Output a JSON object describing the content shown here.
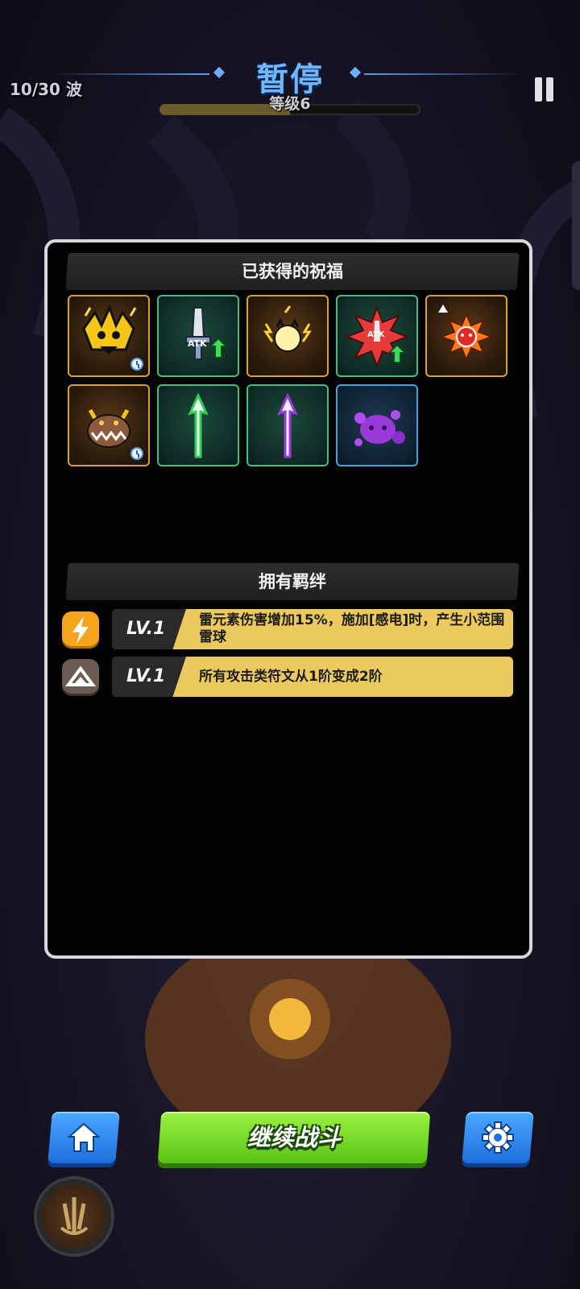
{
  "hud": {
    "wave": "10/30 波",
    "title": "暂停",
    "level": "等级6",
    "level_progress": 0.5
  },
  "panel": {
    "blessings_title": "已获得的祝福",
    "blessings": [
      {
        "icon": "thunder-beast-icon",
        "frame": "gold",
        "timed": true
      },
      {
        "icon": "atk-sword-up-icon",
        "frame": "green",
        "timed": false
      },
      {
        "icon": "electric-spirit-icon",
        "frame": "gold",
        "timed": false
      },
      {
        "icon": "atk-burst-up-icon",
        "frame": "green",
        "timed": false
      },
      {
        "icon": "fire-spirit-icon",
        "frame": "gold",
        "timed": false
      },
      {
        "icon": "horned-chomper-icon",
        "frame": "gold",
        "timed": true
      },
      {
        "icon": "green-arrow-icon",
        "frame": "green",
        "timed": false
      },
      {
        "icon": "purple-arrow-icon",
        "frame": "green",
        "timed": false
      },
      {
        "icon": "purple-slime-icon",
        "frame": "blue",
        "timed": false
      }
    ],
    "bonds_title": "拥有羁绊",
    "bonds": [
      {
        "icon": "lightning-icon",
        "level": "LV.1",
        "text": "雷元素伤害增加15%，施加[感电]时，产生小范围雷球"
      },
      {
        "icon": "rune-icon",
        "level": "LV.1",
        "text": "所有攻击类符文从1阶变成2阶"
      }
    ]
  },
  "buttons": {
    "home": "home-icon",
    "continue": "继续战斗",
    "settings": "gear-icon"
  }
}
